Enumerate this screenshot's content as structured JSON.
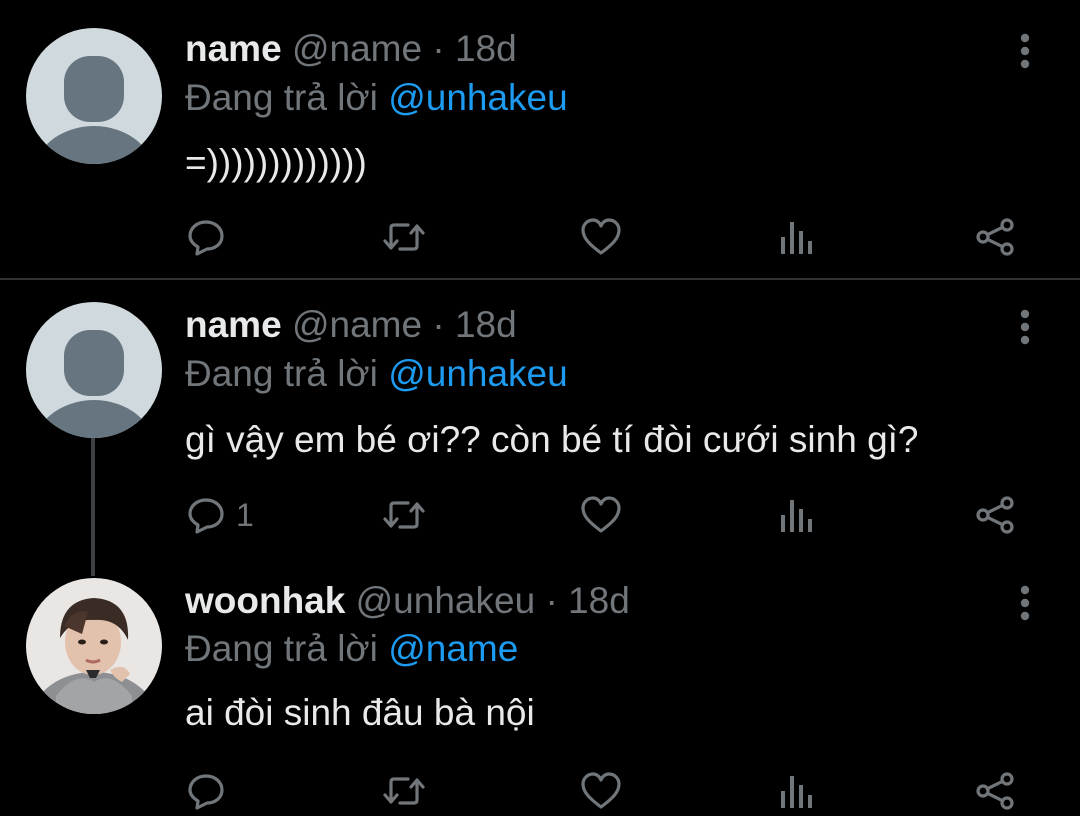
{
  "colors": {
    "background": "#000000",
    "text_primary": "#e7e9ea",
    "text_secondary": "#71767b",
    "mention": "#1d9bf0",
    "divider": "#2f3336"
  },
  "tweets": [
    {
      "display_name": "name",
      "handle": "@name",
      "separator": "·",
      "time": "18d",
      "reply_prefix": "Đang trả lời",
      "reply_to": "@unhakeu",
      "text": "=)))))))))))))",
      "avatar": "default-avatar-icon",
      "reply_count": ""
    },
    {
      "display_name": "name",
      "handle": "@name",
      "separator": "·",
      "time": "18d",
      "reply_prefix": "Đang trả lời",
      "reply_to": "@unhakeu",
      "text": "gì vậy em bé ơi?? còn bé tí đòi cưới sinh gì?",
      "avatar": "default-avatar-icon",
      "reply_count": "1"
    },
    {
      "display_name": "woonhak",
      "handle": "@unhakeu",
      "separator": "·",
      "time": "18d",
      "reply_prefix": "Đang trả lời",
      "reply_to": "@name",
      "text": "ai đòi sinh đâu bà nội",
      "avatar": "user-photo",
      "reply_count": ""
    }
  ],
  "actions": [
    "reply-icon",
    "retweet-icon",
    "like-icon",
    "analytics-icon",
    "share-icon"
  ]
}
